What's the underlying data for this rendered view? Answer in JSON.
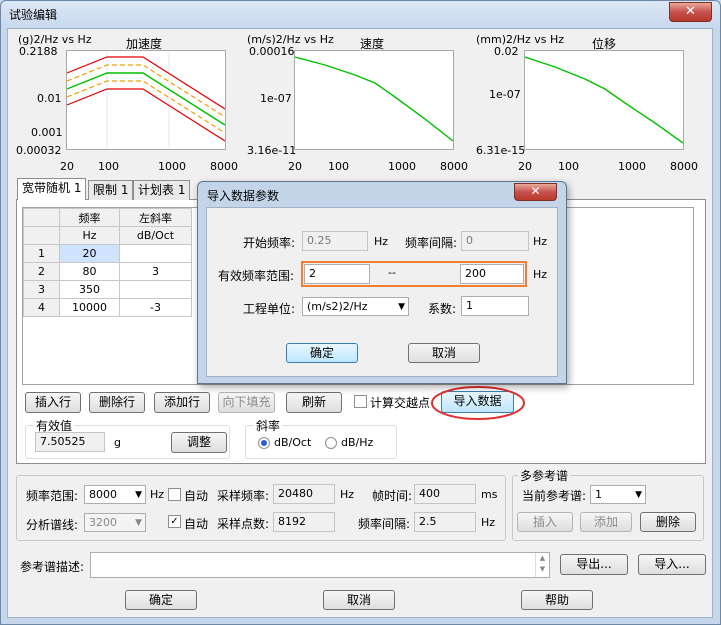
{
  "window": {
    "title": "试验编辑",
    "close": "✕"
  },
  "charts": [
    {
      "unit": "(g)2/Hz vs Hz",
      "title": "加速度",
      "yticks": [
        "0.2188",
        "0.01",
        "0.001",
        "0.00032"
      ],
      "xticks": [
        "20",
        "100",
        "1000",
        "8000"
      ]
    },
    {
      "unit": "(m/s)2/Hz vs Hz",
      "title": "速度",
      "yticks": [
        "0.00016",
        "1e-07",
        "3.16e-11"
      ],
      "xticks": [
        "20",
        "100",
        "1000",
        "8000"
      ]
    },
    {
      "unit": "(mm)2/Hz vs Hz",
      "title": "位移",
      "yticks": [
        "0.02",
        "1e-07",
        "6.31e-15"
      ],
      "xticks": [
        "20",
        "100",
        "1000",
        "8000"
      ]
    }
  ],
  "tabs": [
    "宽带随机 1",
    "限制 1",
    "计划表 1"
  ],
  "grid": {
    "headers": [
      "频率",
      "左斜率"
    ],
    "units": [
      "Hz",
      "dB/Oct"
    ],
    "rows": [
      {
        "n": "1",
        "freq": "20",
        "slope": ""
      },
      {
        "n": "2",
        "freq": "80",
        "slope": "3"
      },
      {
        "n": "3",
        "freq": "350",
        "slope": ""
      },
      {
        "n": "4",
        "freq": "10000",
        "slope": "-3"
      }
    ]
  },
  "buttons": {
    "insert_row": "插入行",
    "delete_row": "删除行",
    "add_row": "添加行",
    "fill_down": "向下填充",
    "refresh": "刷新",
    "calc_cross": "计算交越点",
    "import_data": "导入数据",
    "adjust": "调整",
    "insert": "插入",
    "add": "添加",
    "delete": "删除",
    "export": "导出...",
    "import": "导入...",
    "ok": "确定",
    "cancel": "取消",
    "help": "帮助"
  },
  "rms": {
    "label": "有效值",
    "value": "7.50525",
    "unit": "g"
  },
  "slope": {
    "label": "斜率",
    "opt1": "dB/Oct",
    "opt2": "dB/Hz"
  },
  "settings": {
    "freq_range_label": "频率范围:",
    "freq_range": "8000",
    "hz": "Hz",
    "auto": "自动",
    "sample_rate_label": "采样频率:",
    "sample_rate": "20480",
    "frame_time_label": "帧时间:",
    "frame_time": "400",
    "ms": "ms",
    "lines_label": "分析谱线:",
    "lines": "3200",
    "points_label": "采样点数:",
    "points": "8192",
    "interval_label": "频率间隔:",
    "interval": "2.5"
  },
  "multi": {
    "label": "多参考谱",
    "current_label": "当前参考谱:",
    "current": "1"
  },
  "desc": {
    "label": "参考谱描述:"
  },
  "dialog": {
    "title": "导入数据参数",
    "close": "✕",
    "start_label": "开始频率:",
    "start": "0.25",
    "hz": "Hz",
    "interval_label": "频率间隔:",
    "interval": "0",
    "range_label": "有效频率范围:",
    "range_from": "2",
    "dash": "--",
    "range_to": "200",
    "unit_label": "工程单位:",
    "unit": "(m/s2)2/Hz",
    "coef_label": "系数:",
    "coef": "1",
    "ok": "确定",
    "cancel": "取消"
  },
  "colors": {
    "red": "#e00000",
    "orange": "#f0a000",
    "green": "#00c000",
    "highlight": "#f08030",
    "annot": "#e03030"
  }
}
